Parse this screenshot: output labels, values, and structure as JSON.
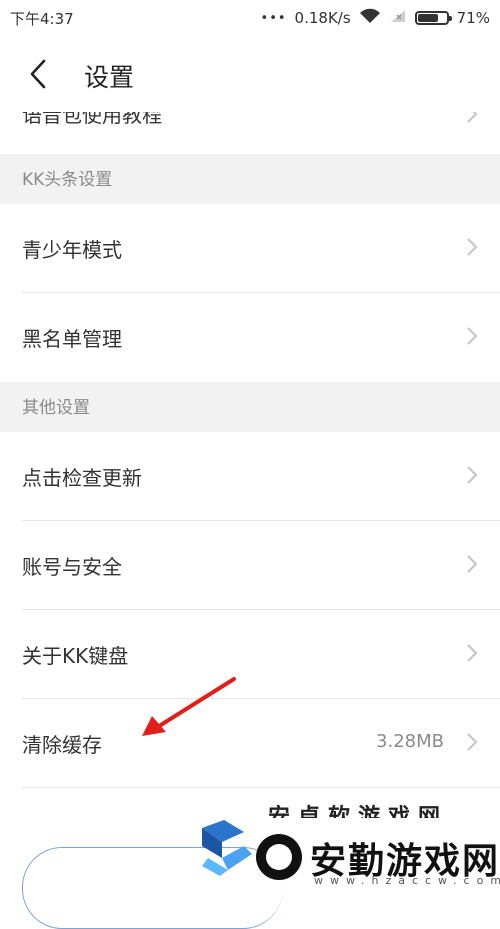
{
  "status_bar": {
    "time": "下午4:37",
    "dots": "•••",
    "speed": "0.18K/s",
    "battery": "71%",
    "battery_level": 0.71
  },
  "header": {
    "title": "设置"
  },
  "clipped_row": {
    "label": "语音包使用教程"
  },
  "sections": [
    {
      "header": "KK头条设置",
      "rows": [
        {
          "label": "青少年模式"
        },
        {
          "label": "黑名单管理"
        }
      ]
    },
    {
      "header": "其他设置",
      "rows": [
        {
          "label": "点击检查更新"
        },
        {
          "label": "账号与安全"
        },
        {
          "label": "关于KK键盘"
        },
        {
          "label": "清除缓存",
          "value": "3.28MB"
        }
      ]
    }
  ],
  "watermark": {
    "brand": "安勤游戏网",
    "url": "www.hzaccw.com",
    "top_text": "安卓软游戏网"
  },
  "colors": {
    "section_bg": "#f2f2f2",
    "arrow": "#e0201c",
    "outline": "#7fa2d6"
  }
}
